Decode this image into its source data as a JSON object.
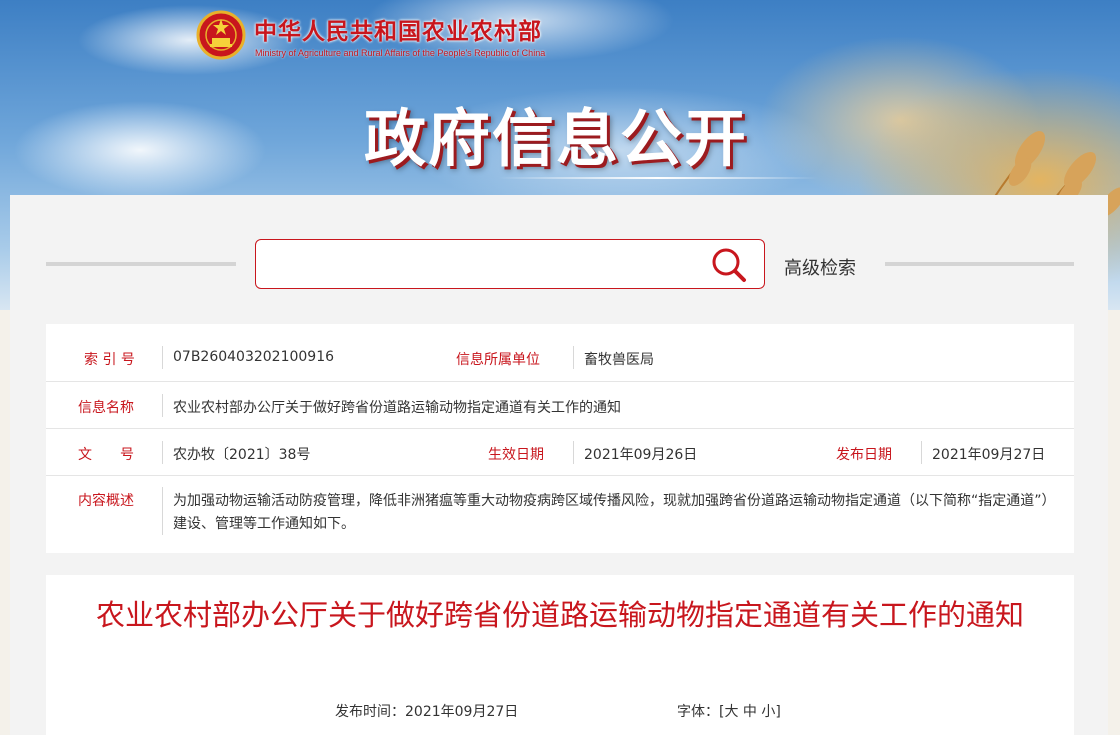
{
  "header": {
    "ministry_cn": "中华人民共和国农业农村部",
    "ministry_en": "Ministry of Agriculture and Rural Affairs of the People's Republic of China",
    "banner_title": "政府信息公开"
  },
  "search": {
    "value": "",
    "advanced_label": "高级检索"
  },
  "info": {
    "index_label": "索 引 号",
    "index_value": "07B260403202100916",
    "unit_label": "信息所属单位",
    "unit_value": "畜牧兽医局",
    "name_label": "信息名称",
    "name_value": "农业农村部办公厅关于做好跨省份道路运输动物指定通道有关工作的通知",
    "doc_label": "文　　号",
    "doc_value": "农办牧〔2021〕38号",
    "effective_label": "生效日期",
    "effective_value": "2021年09月26日",
    "publish_label": "发布日期",
    "publish_value": "2021年09月27日",
    "summary_label": "内容概述",
    "summary_value": "为加强动物运输活动防疫管理，降低非洲猪瘟等重大动物疫病跨区域传播风险，现就加强跨省份道路运输动物指定通道（以下简称“指定通道”）建设、管理等工作通知如下。"
  },
  "article": {
    "title": "农业农村部办公厅关于做好跨省份道路运输动物指定通道有关工作的通知",
    "pub_time_label": "发布时间：",
    "pub_time_value": "2021年09月27日",
    "font_label": "字体：",
    "font_open": "[",
    "font_large": "大",
    "font_medium": "中",
    "font_small": "小",
    "font_close": "]"
  },
  "colors": {
    "accent": "#c8161d",
    "panel_bg": "#f3f3f3"
  }
}
